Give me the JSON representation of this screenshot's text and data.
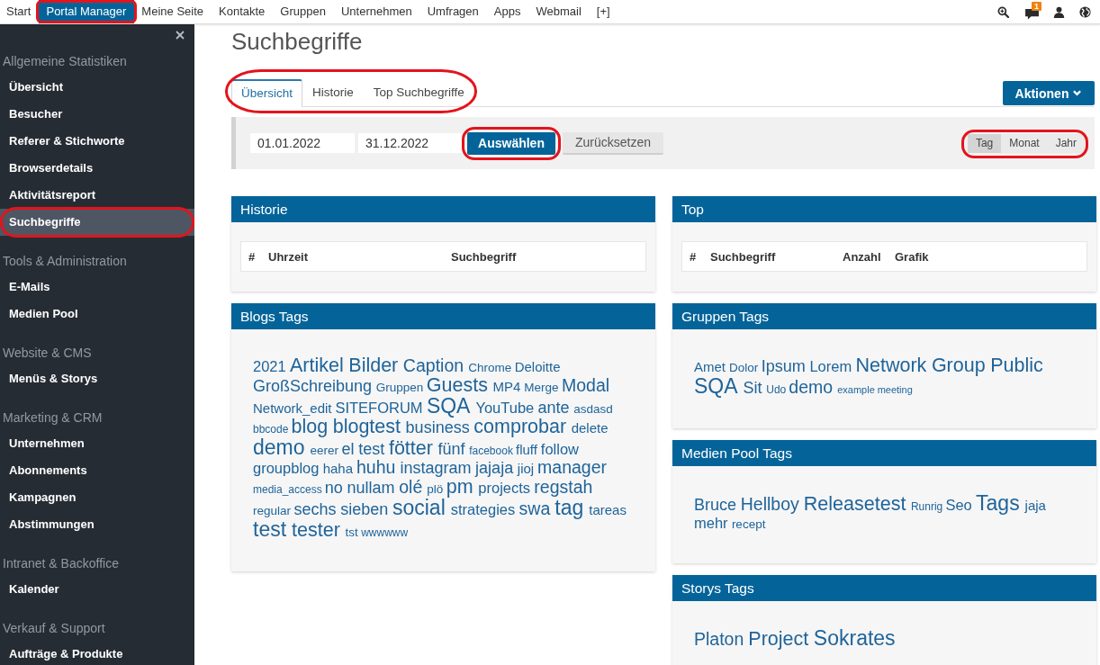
{
  "top_nav": {
    "items": [
      {
        "label": "Start",
        "selected": false,
        "highlighted": false
      },
      {
        "label": "Portal Manager",
        "selected": true,
        "highlighted": true
      },
      {
        "label": "Meine Seite",
        "selected": false,
        "highlighted": false
      },
      {
        "label": "Kontakte",
        "selected": false,
        "highlighted": false
      },
      {
        "label": "Gruppen",
        "selected": false,
        "highlighted": false
      },
      {
        "label": "Unternehmen",
        "selected": false,
        "highlighted": false
      },
      {
        "label": "Umfragen",
        "selected": false,
        "highlighted": false
      },
      {
        "label": "Apps",
        "selected": false,
        "highlighted": false
      },
      {
        "label": "Webmail",
        "selected": false,
        "highlighted": false
      },
      {
        "label": "[+]",
        "selected": false,
        "highlighted": false
      }
    ],
    "notification_count": "1"
  },
  "sidebar": {
    "groups": [
      {
        "title": "Allgemeine Statistiken",
        "items": [
          {
            "label": "Übersicht",
            "selected": false,
            "highlighted": false
          },
          {
            "label": "Besucher",
            "selected": false,
            "highlighted": false
          },
          {
            "label": "Referer & Stichworte",
            "selected": false,
            "highlighted": false
          },
          {
            "label": "Browserdetails",
            "selected": false,
            "highlighted": false
          },
          {
            "label": "Aktivitätsreport",
            "selected": false,
            "highlighted": false
          },
          {
            "label": "Suchbegriffe",
            "selected": true,
            "highlighted": true
          }
        ]
      },
      {
        "title": "Tools & Administration",
        "items": [
          {
            "label": "E-Mails",
            "selected": false,
            "highlighted": false
          },
          {
            "label": "Medien Pool",
            "selected": false,
            "highlighted": false
          }
        ]
      },
      {
        "title": "Website & CMS",
        "items": [
          {
            "label": "Menüs & Storys",
            "selected": false,
            "highlighted": false
          }
        ]
      },
      {
        "title": "Marketing & CRM",
        "items": [
          {
            "label": "Unternehmen",
            "selected": false,
            "highlighted": false
          },
          {
            "label": "Abonnements",
            "selected": false,
            "highlighted": false
          },
          {
            "label": "Kampagnen",
            "selected": false,
            "highlighted": false
          },
          {
            "label": "Abstimmungen",
            "selected": false,
            "highlighted": false
          }
        ]
      },
      {
        "title": "Intranet & Backoffice",
        "items": [
          {
            "label": "Kalender",
            "selected": false,
            "highlighted": false
          }
        ]
      },
      {
        "title": "Verkauf & Support",
        "items": [
          {
            "label": "Aufträge & Produkte",
            "selected": false,
            "highlighted": false
          }
        ]
      }
    ]
  },
  "page_title": "Suchbegriffe",
  "tabs": {
    "highlighted": true,
    "items": [
      {
        "label": "Übersicht",
        "selected": true
      },
      {
        "label": "Historie",
        "selected": false
      },
      {
        "label": "Top Suchbegriffe",
        "selected": false
      }
    ]
  },
  "actions_button": "Aktionen",
  "filter": {
    "date_from": "01.01.2022",
    "date_to": "31.12.2022",
    "select_button": {
      "label": "Auswählen",
      "highlighted": true
    },
    "reset_button": "Zurücksetzen",
    "periods": {
      "highlighted": true,
      "items": [
        {
          "label": "Tag",
          "selected": true
        },
        {
          "label": "Monat",
          "selected": false
        },
        {
          "label": "Jahr",
          "selected": false
        }
      ]
    }
  },
  "left_panels": [
    {
      "title": "Historie",
      "kind": "table",
      "columns": [
        "#",
        "Uhrzeit",
        "Suchbegriff"
      ]
    },
    {
      "title": "Blogs Tags",
      "kind": "tags",
      "tags": [
        {
          "text": "2021",
          "kind": "tier5"
        },
        {
          "text": "Artikel",
          "kind": "tier8"
        },
        {
          "text": "Bilder",
          "kind": "tier8"
        },
        {
          "text": "Caption",
          "kind": "tier7"
        },
        {
          "text": "Chrome",
          "kind": "tier3"
        },
        {
          "text": "Deloitte",
          "kind": "tier4"
        },
        {
          "text": "GroßSchreibung",
          "kind": "tier6"
        },
        {
          "text": "Gruppen",
          "kind": "tier3"
        },
        {
          "text": "Guests",
          "kind": "tier8"
        },
        {
          "text": "MP4",
          "kind": "tier4"
        },
        {
          "text": "Merge",
          "kind": "tier3"
        },
        {
          "text": "Modal",
          "kind": "tier7"
        },
        {
          "text": "Network_edit",
          "kind": "tier4"
        },
        {
          "text": "SITEFORUM",
          "kind": "tier5"
        },
        {
          "text": "SQA",
          "kind": "tier9"
        },
        {
          "text": "YouTube",
          "kind": "tier5"
        },
        {
          "text": "ante",
          "kind": "tier6"
        },
        {
          "text": "asdasd",
          "kind": "tier3"
        },
        {
          "text": "bbcode",
          "kind": "tier2"
        },
        {
          "text": "blog",
          "kind": "tier8"
        },
        {
          "text": "blogtest",
          "kind": "tier8"
        },
        {
          "text": "business",
          "kind": "tier6"
        },
        {
          "text": "comprobar",
          "kind": "tier8"
        },
        {
          "text": "delete",
          "kind": "tier4"
        },
        {
          "text": "demo",
          "kind": "tier9"
        },
        {
          "text": "eerer",
          "kind": "tier3"
        },
        {
          "text": "el",
          "kind": "tier6"
        },
        {
          "text": "test",
          "kind": "tier6"
        },
        {
          "text": "fötter",
          "kind": "tier8"
        },
        {
          "text": "fünf",
          "kind": "tier6"
        },
        {
          "text": "facebook",
          "kind": "tier2"
        },
        {
          "text": "fluff",
          "kind": "tier4"
        },
        {
          "text": "follow",
          "kind": "tier5"
        },
        {
          "text": "groupblog",
          "kind": "tier5"
        },
        {
          "text": "haha",
          "kind": "tier4"
        },
        {
          "text": "huhu",
          "kind": "tier7"
        },
        {
          "text": "instagram",
          "kind": "tier6"
        },
        {
          "text": "jajaja",
          "kind": "tier6"
        },
        {
          "text": "jioj",
          "kind": "tier4"
        },
        {
          "text": "manager",
          "kind": "tier7"
        },
        {
          "text": "media_access",
          "kind": "tier2"
        },
        {
          "text": "no",
          "kind": "tier6"
        },
        {
          "text": "nullam",
          "kind": "tier6"
        },
        {
          "text": "olé",
          "kind": "tier7"
        },
        {
          "text": "plö",
          "kind": "tier3"
        },
        {
          "text": "pm",
          "kind": "tier8"
        },
        {
          "text": "projects",
          "kind": "tier5"
        },
        {
          "text": "regstah",
          "kind": "tier7"
        },
        {
          "text": "regular",
          "kind": "tier3"
        },
        {
          "text": "sechs",
          "kind": "tier6"
        },
        {
          "text": "sieben",
          "kind": "tier6"
        },
        {
          "text": "social",
          "kind": "tier9"
        },
        {
          "text": "strategies",
          "kind": "tier5"
        },
        {
          "text": "swa",
          "kind": "tier7"
        },
        {
          "text": "tag",
          "kind": "tier9"
        },
        {
          "text": "tareas",
          "kind": "tier4"
        },
        {
          "text": "test",
          "kind": "tier9"
        },
        {
          "text": "tester",
          "kind": "tier8"
        },
        {
          "text": "tst",
          "kind": "tier3"
        },
        {
          "text": "wwwwww",
          "kind": "tier2"
        }
      ]
    }
  ],
  "right_panels": [
    {
      "title": "Top",
      "kind": "table",
      "columns": [
        "#",
        "Suchbegriff",
        "Anzahl",
        "Grafik"
      ]
    },
    {
      "title": "Gruppen Tags",
      "kind": "tags",
      "tags": [
        {
          "text": "Amet",
          "kind": "tier4"
        },
        {
          "text": "Dolor",
          "kind": "tier3"
        },
        {
          "text": "Ipsum",
          "kind": "tier6"
        },
        {
          "text": "Lorem",
          "kind": "tier5"
        },
        {
          "text": "Network",
          "kind": "tier8"
        },
        {
          "text": "Group",
          "kind": "tier8"
        },
        {
          "text": "Public",
          "kind": "tier8"
        },
        {
          "text": "SQA",
          "kind": "tier9"
        },
        {
          "text": "Sit",
          "kind": "tier6"
        },
        {
          "text": "Udo",
          "kind": "tier2"
        },
        {
          "text": "demo",
          "kind": "tier7"
        },
        {
          "text": "example",
          "kind": "tier1"
        },
        {
          "text": "meeting",
          "kind": "tier1"
        }
      ]
    },
    {
      "title": "Medien Pool Tags",
      "kind": "tags",
      "tags": [
        {
          "text": "Bruce",
          "kind": "tier6"
        },
        {
          "text": "Hellboy",
          "kind": "tier7"
        },
        {
          "text": "Releasetest",
          "kind": "tier8"
        },
        {
          "text": "Runrig",
          "kind": "tier2"
        },
        {
          "text": "Seo",
          "kind": "tier5"
        },
        {
          "text": "Tags",
          "kind": "tier9"
        },
        {
          "text": "jaja",
          "kind": "tier4"
        },
        {
          "text": "mehr",
          "kind": "tier5"
        },
        {
          "text": "recept",
          "kind": "tier3"
        }
      ]
    },
    {
      "title": "Storys Tags",
      "kind": "tags",
      "tags": [
        {
          "text": "Platon",
          "kind": "tier7"
        },
        {
          "text": "Project",
          "kind": "tier8"
        },
        {
          "text": "Sokrates",
          "kind": "tier9"
        }
      ]
    }
  ]
}
